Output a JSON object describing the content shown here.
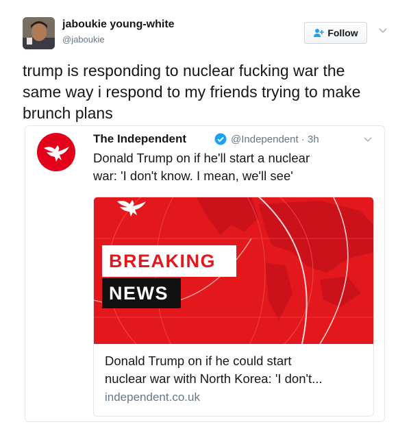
{
  "user": {
    "name": "jaboukie young-white",
    "handle": "@jaboukie"
  },
  "follow_button": {
    "label": "Follow"
  },
  "tweet": {
    "lines": [
      "trump is responding to nuclear fucking war the",
      "same way i respond to my friends trying to make",
      "brunch plans"
    ]
  },
  "quoted": {
    "name": "The Independent",
    "handle_time": "@Independent · 3h",
    "lines": [
      "Donald Trump on if he'll start a nuclear",
      "war: 'I don't know. I mean, we'll see'"
    ],
    "link_card": {
      "image_text_1": "BREAKING",
      "image_text_2": "NEWS",
      "title_lines": [
        "Donald Trump on if he could start",
        "nuclear war with North Korea: 'I don't..."
      ],
      "domain": "independent.co.uk"
    }
  },
  "colors": {
    "brand_red": "#e2181c",
    "twitter_blue": "#1da1f2",
    "text_secondary": "#657786"
  },
  "icons": [
    "follow-person-icon",
    "chevron-down-icon",
    "verified-badge-icon",
    "independent-eagle-logo"
  ]
}
